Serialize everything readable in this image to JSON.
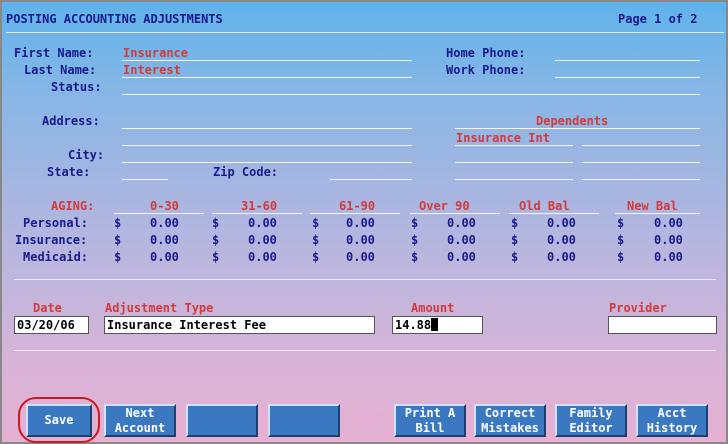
{
  "header": {
    "title": "POSTING ACCOUNTING ADJUSTMENTS",
    "page": "Page 1 of 2"
  },
  "patient": {
    "first_name_label": "First Name:",
    "first_name": "Insurance",
    "last_name_label": "Last Name:",
    "last_name": "Interest",
    "status_label": "Status:",
    "home_phone_label": "Home Phone:",
    "work_phone_label": "Work Phone:",
    "address_label": "Address:",
    "city_label": "City:",
    "state_label": "State:",
    "zip_label": "Zip Code:"
  },
  "dependents": {
    "label": "Dependents",
    "first": "Insurance Int"
  },
  "aging": {
    "label": "AGING:",
    "columns": [
      "0-30",
      "31-60",
      "61-90",
      "Over 90",
      "Old Bal",
      "New Bal"
    ],
    "currency": "$",
    "rows": [
      {
        "label": "Personal:",
        "values": [
          "0.00",
          "0.00",
          "0.00",
          "0.00",
          "0.00",
          "0.00"
        ]
      },
      {
        "label": "Insurance:",
        "values": [
          "0.00",
          "0.00",
          "0.00",
          "0.00",
          "0.00",
          "0.00"
        ]
      },
      {
        "label": "Medicaid:",
        "values": [
          "0.00",
          "0.00",
          "0.00",
          "0.00",
          "0.00",
          "0.00"
        ]
      }
    ]
  },
  "adjustment": {
    "date_label": "Date",
    "date": "03/20/06",
    "type_label": "Adjustment Type",
    "type": "Insurance Interest Fee",
    "amount_label": "Amount",
    "amount": "14.88",
    "provider_label": "Provider",
    "provider": ""
  },
  "buttons": {
    "save": "Save",
    "next_account": [
      "Next",
      "Account"
    ],
    "print_bill": [
      "Print A",
      "Bill"
    ],
    "correct_mistakes": [
      "Correct",
      "Mistakes"
    ],
    "family_editor": [
      "Family",
      "Editor"
    ],
    "acct_history": [
      "Acct",
      "History"
    ]
  }
}
